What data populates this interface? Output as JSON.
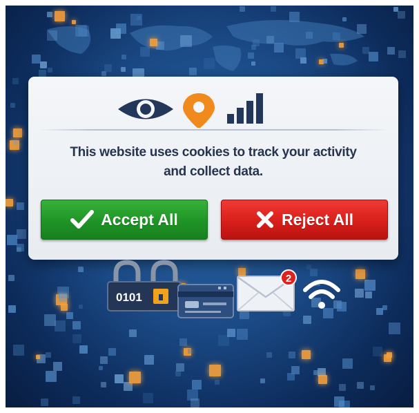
{
  "dialog": {
    "message_line1": "This website uses cookies to track your activity",
    "message_line2": "and collect data.",
    "icons": [
      "eye-icon",
      "location-pin-icon",
      "signal-bars-icon"
    ]
  },
  "buttons": {
    "accept_label": "Accept All",
    "reject_label": "Reject All"
  },
  "bottom_icons": {
    "lock_text": "0101",
    "mail_badge_count": "2",
    "icons": [
      "padlock-icon",
      "credit-card-icon",
      "envelope-icon",
      "wifi-icon"
    ]
  },
  "colors": {
    "accept": "#1f9426",
    "reject": "#d81f1b",
    "pin": "#f08a1d",
    "icon_navy": "#22375a",
    "badge": "#e0211c"
  }
}
